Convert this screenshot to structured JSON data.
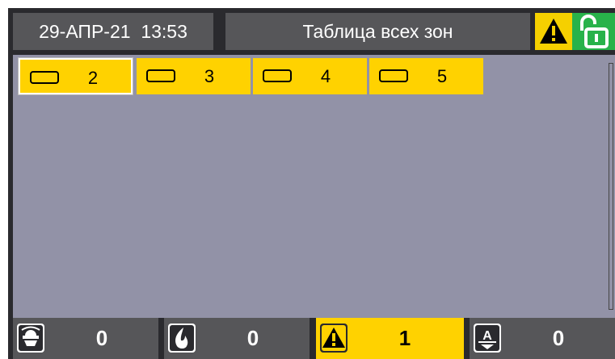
{
  "header": {
    "date": "29-АПР-21",
    "time": "13:53",
    "title": "Таблица всех зон",
    "warning_icon": "warning-triangle-icon",
    "lock_icon": "unlocked-padlock-icon"
  },
  "zones": [
    {
      "number": "2",
      "selected": true
    },
    {
      "number": "3",
      "selected": false
    },
    {
      "number": "4",
      "selected": false
    },
    {
      "number": "5",
      "selected": false
    }
  ],
  "footer": {
    "alarm": {
      "icon": "alarm-detector-icon",
      "count": "0"
    },
    "fire": {
      "icon": "fire-flame-icon",
      "count": "0"
    },
    "fault": {
      "icon": "warning-triangle-icon",
      "count": "1"
    },
    "disabled": {
      "icon": "disabled-zone-icon",
      "count": "0"
    }
  },
  "colors": {
    "tile": "#ffd200",
    "background": "#9292a7",
    "panel": "#565659",
    "accent_green": "#28b24a"
  }
}
